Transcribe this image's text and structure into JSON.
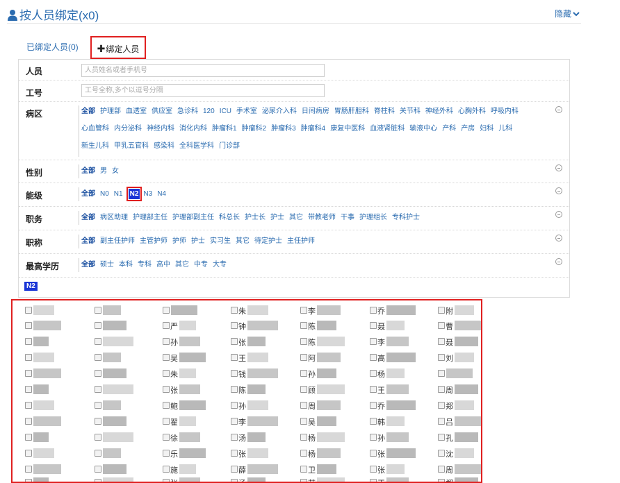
{
  "header": {
    "title": "按人员绑定(x0)",
    "hide_label": "隐藏"
  },
  "tabs": {
    "bound_label": "已绑定人员(0)",
    "add_label": "绑定人员"
  },
  "filters": {
    "person": {
      "label": "人员",
      "placeholder": "人员姓名或者手机号"
    },
    "job_no": {
      "label": "工号",
      "placeholder": "工号全称,多个以逗号分隔"
    },
    "ward": {
      "label": "病区",
      "options": [
        "全部",
        "护理部",
        "血透室",
        "供应室",
        "急诊科",
        "120",
        "ICU",
        "手术室",
        "泌尿介入科",
        "日间病房",
        "胃肠肝胆科",
        "脊柱科",
        "关节科",
        "神经外科",
        "心胸外科",
        "呼吸内科",
        "心血管科",
        "内分泌科",
        "神经内科",
        "消化内科",
        "肿瘤科1",
        "肿瘤科2",
        "肿瘤科3",
        "肿瘤科4",
        "康复中医科",
        "血液肾脏科",
        "输液中心",
        "产科",
        "产房",
        "妇科",
        "儿科",
        "新生儿科",
        "甲乳五官科",
        "感染科",
        "全科医学科",
        "门诊部"
      ]
    },
    "gender": {
      "label": "性别",
      "options": [
        "全部",
        "男",
        "女"
      ]
    },
    "level": {
      "label": "能级",
      "options": [
        "全部",
        "N0",
        "N1",
        "N2",
        "N3",
        "N4"
      ],
      "selected": "N2"
    },
    "duty": {
      "label": "职务",
      "options": [
        "全部",
        "病区助理",
        "护理部主任",
        "护理部副主任",
        "科总长",
        "护士长",
        "护士",
        "其它",
        "带教老师",
        "干事",
        "护理组长",
        "专科护士"
      ]
    },
    "title": {
      "label": "职称",
      "options": [
        "全部",
        "副主任护师",
        "主管护师",
        "护师",
        "护士",
        "实习生",
        "其它",
        "待定护士",
        "主任护师"
      ]
    },
    "education": {
      "label": "最高学历",
      "options": [
        "全部",
        "硕士",
        "本科",
        "专科",
        "高中",
        "其它",
        "中专",
        "大专"
      ]
    }
  },
  "selected_chip": "N2",
  "people": {
    "columns": [
      [
        "",
        "",
        "",
        "",
        "",
        "",
        "",
        "",
        "",
        "",
        "",
        "",
        ""
      ],
      [
        "",
        "",
        "",
        "",
        "",
        "",
        "",
        "",
        "",
        "",
        "",
        "",
        ""
      ],
      [
        "",
        "严",
        "孙",
        "吴",
        "朱",
        "张",
        "鲍",
        "翟",
        "徐",
        "乐",
        "施",
        "张",
        ""
      ],
      [
        "朱",
        "钟",
        "张",
        "王",
        "钱",
        "陈",
        "孙",
        "李",
        "汤",
        "张",
        "薛",
        "汤",
        ""
      ],
      [
        "李",
        "陈",
        "陈",
        "阿",
        "孙",
        "顾",
        "周",
        "吴",
        "杨",
        "杨",
        "卫",
        "范",
        ""
      ],
      [
        "乔",
        "聂",
        "李",
        "高",
        "杨",
        "王",
        "乔",
        "韩",
        "孙",
        "张",
        "张",
        "王",
        ""
      ],
      [
        "附",
        "曹",
        "聂",
        "刘",
        "",
        "周",
        "郑",
        "吕",
        "孔",
        "沈",
        "周",
        "郑",
        ""
      ]
    ]
  }
}
